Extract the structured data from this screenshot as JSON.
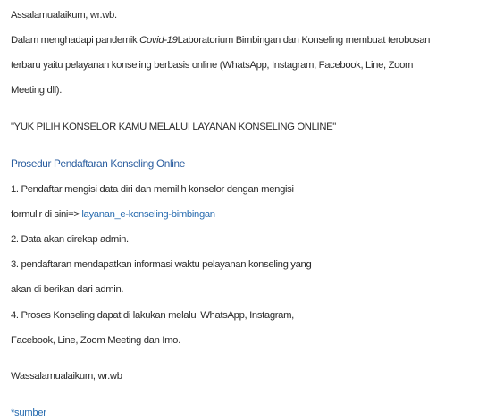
{
  "article": {
    "greeting": "Assalamualaikum, wr.wb.",
    "intro_pre": "Dalam menghadapi pandemik ",
    "intro_em": "Covid-19",
    "intro_post": "Laboratorium Bimbingan dan Konseling membuat terobosan",
    "intro_line2": "terbaru yaitu pelayanan konseling berbasis online (WhatsApp, Instagram, Facebook, Line, Zoom",
    "intro_line3": "Meeting dll).",
    "tagline": "\"YUK PILIH KONSELOR KAMU MELALUI LAYANAN KONSELING ONLINE\"",
    "procedure_heading": "Prosedur Pendaftaran Konseling Online",
    "step1_line1": "1. Pendaftar mengisi data diri dan memilih konselor dengan mengisi",
    "step1_line2_pre": "formulir di sini=> ",
    "step1_link": "layanan_e-konseling-bimbingan",
    "step2": "2. Data akan direkap admin.",
    "step3_line1": "3. pendaftaran mendapatkan informasi waktu pelayanan konseling yang",
    "step3_line2": "akan di berikan dari admin.",
    "step4_line1": "4. Proses Konseling dapat di lakukan melalui WhatsApp, Instagram,",
    "step4_line2": "Facebook, Line, Zoom Meeting dan Imo.",
    "closing": "Wassalamualaikum, wr.wb",
    "source_link": "*sumber"
  },
  "colors": {
    "text": "#2b2b2b",
    "link": "#2a6db0",
    "heading": "#2a5d9f",
    "background": "#ffffff"
  }
}
